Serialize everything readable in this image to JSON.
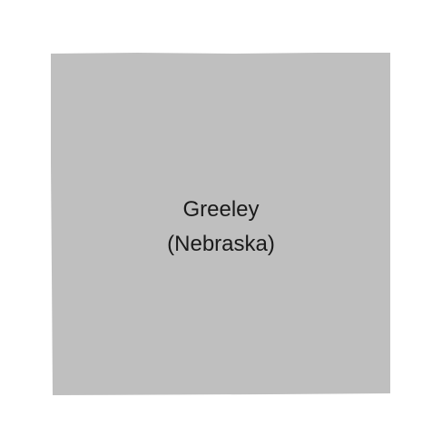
{
  "map": {
    "region": {
      "name": "Greeley",
      "state": "(Nebraska)",
      "fill_color": "#bfbfbf"
    },
    "background_color": "#ffffff"
  }
}
